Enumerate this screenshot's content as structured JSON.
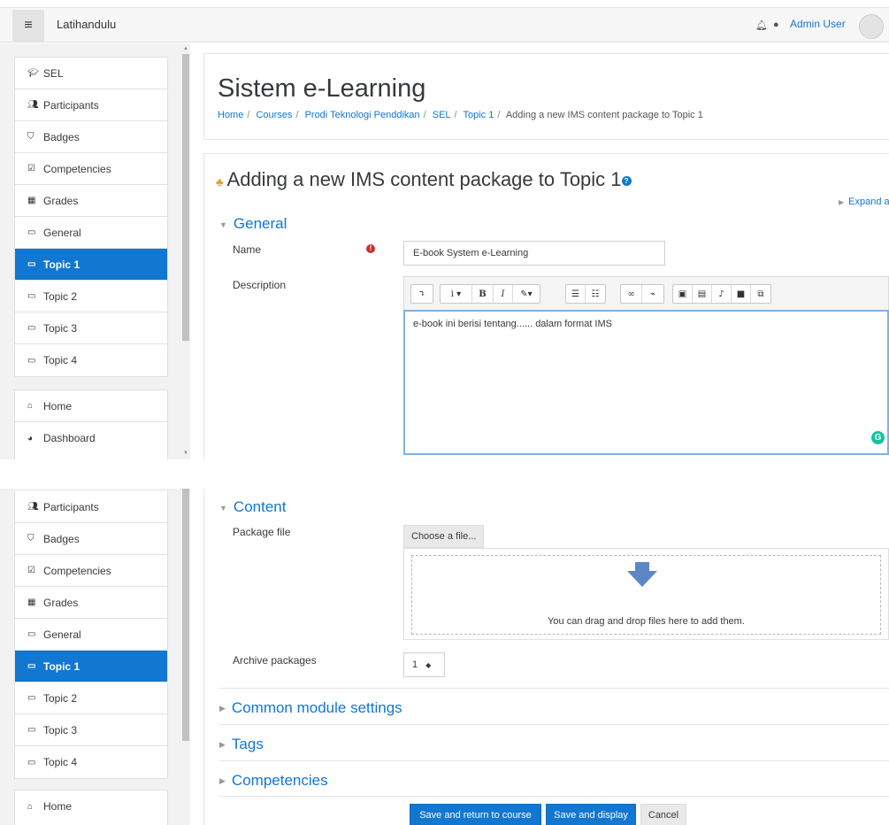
{
  "navbar": {
    "menu_icon": "hamburger-icon",
    "site_name": "Latihandulu",
    "user_name": "Admin User"
  },
  "nav_top": {
    "items": [
      {
        "label": "SEL",
        "icon": "graduation-cap-icon"
      },
      {
        "label": "Participants",
        "icon": "users-icon"
      },
      {
        "label": "Badges",
        "icon": "shield-icon"
      },
      {
        "label": "Competencies",
        "icon": "checkbox-icon"
      },
      {
        "label": "Grades",
        "icon": "table-icon"
      },
      {
        "label": "General",
        "icon": "folder-icon"
      },
      {
        "label": "Topic 1",
        "icon": "folder-icon"
      },
      {
        "label": "Topic 2",
        "icon": "folder-icon"
      },
      {
        "label": "Topic 3",
        "icon": "folder-icon"
      },
      {
        "label": "Topic 4",
        "icon": "folder-icon"
      }
    ],
    "home": "Home",
    "dashboard": "Dashboard"
  },
  "nav_bottom": {
    "items": [
      {
        "label": "Participants"
      },
      {
        "label": "Badges"
      },
      {
        "label": "Competencies"
      },
      {
        "label": "Grades"
      },
      {
        "label": "General"
      },
      {
        "label": "Topic 1"
      },
      {
        "label": "Topic 2"
      },
      {
        "label": "Topic 3"
      },
      {
        "label": "Topic 4"
      }
    ],
    "home": "Home"
  },
  "header": {
    "course_title": "Sistem e-Learning",
    "breadcrumb": [
      "Home",
      "Courses",
      "Prodi Teknologi Penddikan",
      "SEL",
      "Topic 1",
      "Adding a new IMS content package to Topic 1"
    ]
  },
  "form": {
    "heading": "Adding a new IMS content package to Topic 1",
    "expand_all": "Expand al",
    "general": {
      "title": "General",
      "name_label": "Name",
      "name_value": "E-book System e-Learning",
      "description_label": "Description",
      "description_value": "e-book ini berisi tentang...... dalam format IMS"
    },
    "content": {
      "title": "Content",
      "package_label": "Package file",
      "choose_file": "Choose a file...",
      "drop_text": "You can drag and drop files here to add them.",
      "archive_label": "Archive packages",
      "archive_value": "1"
    },
    "collapsed_sections": [
      "Common module settings",
      "Tags",
      "Competencies"
    ],
    "buttons": {
      "save_return": "Save and return to course",
      "save_display": "Save and display",
      "cancel": "Cancel"
    }
  },
  "colors": {
    "brand": "#1177d1",
    "required": "#c9302c"
  }
}
